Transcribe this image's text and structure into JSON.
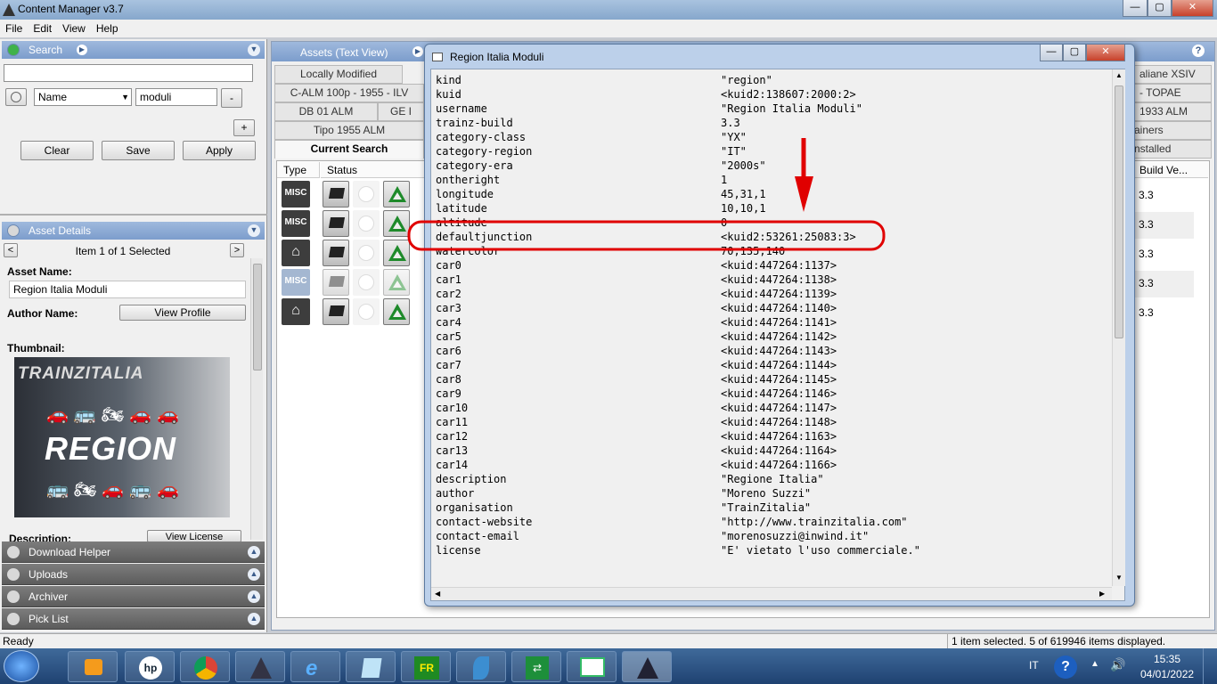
{
  "window": {
    "title": "Content Manager v3.7"
  },
  "menu": [
    "File",
    "Edit",
    "View",
    "Help"
  ],
  "search": {
    "header": "Search",
    "query_value": "",
    "field_select": "Name",
    "field_value": "moduli",
    "minus_label": "-",
    "plus_label": "+",
    "clear_label": "Clear",
    "save_label": "Save",
    "apply_label": "Apply"
  },
  "asset_details": {
    "header": "Asset Details",
    "nav_prev": "<",
    "nav_next": ">",
    "selection": "Item 1 of 1 Selected",
    "asset_name_label": "Asset Name:",
    "asset_name_value": "Region Italia Moduli",
    "author_label": "Author Name:",
    "view_profile_label": "View Profile",
    "thumbnail_label": "Thumbnail:",
    "thumb_brand": "TRAINZITALIA",
    "thumb_title": "REGION",
    "description_label": "Description:",
    "view_license_label": "View License"
  },
  "collapsed_panels": [
    "Download Helper",
    "Uploads",
    "Archiver",
    "Pick List"
  ],
  "assets_panel": {
    "header_tab": "Assets (Text View)",
    "help": "?",
    "tabs_row1": [
      "Locally Modified"
    ],
    "tabs_row2": [
      "C-ALM 100p - 1955 - ILV"
    ],
    "tabs_row3": [
      "DB 01 ALM",
      "GE I"
    ],
    "tabs_row4": [
      "Tipo 1955 ALM"
    ],
    "current_search": "Current Search",
    "right_tabs": [
      "aliane XSIV",
      "- TOPAE",
      "1933 ALM",
      "ainers",
      "nstalled"
    ],
    "columns": {
      "type": "Type",
      "status": "Status",
      "build": "Build Ve..."
    },
    "rows": [
      {
        "type": "MISC",
        "build": "3.3"
      },
      {
        "type": "MISC",
        "build": "3.3"
      },
      {
        "type": "HOME",
        "build": "3.3"
      },
      {
        "type": "MISC",
        "build": "3.3"
      },
      {
        "type": "HOME",
        "build": "3.3"
      }
    ]
  },
  "dialog": {
    "title": "Region Italia Moduli",
    "min": "—",
    "max": "▢",
    "close": "✕",
    "properties": [
      {
        "k": "kind",
        "v": "\"region\""
      },
      {
        "k": "kuid",
        "v": "<kuid2:138607:2000:2>"
      },
      {
        "k": "username",
        "v": "\"Region Italia Moduli\""
      },
      {
        "k": "trainz-build",
        "v": "3.3"
      },
      {
        "k": "category-class",
        "v": "\"YX\""
      },
      {
        "k": "category-region",
        "v": "\"IT\""
      },
      {
        "k": "category-era",
        "v": "\"2000s\""
      },
      {
        "k": "ontheright",
        "v": "1"
      },
      {
        "k": "longitude",
        "v": "45,31,1"
      },
      {
        "k": "latitude",
        "v": "10,10,1"
      },
      {
        "k": "altitude",
        "v": "0"
      },
      {
        "k": "defaultjunction",
        "v": "<kuid2:53261:25083:3>"
      },
      {
        "k": "watercolor",
        "v": "70,135,140"
      },
      {
        "k": "car0",
        "v": "<kuid:447264:1137>"
      },
      {
        "k": "car1",
        "v": "<kuid:447264:1138>"
      },
      {
        "k": "car2",
        "v": "<kuid:447264:1139>"
      },
      {
        "k": "car3",
        "v": "<kuid:447264:1140>"
      },
      {
        "k": "car4",
        "v": "<kuid:447264:1141>"
      },
      {
        "k": "car5",
        "v": "<kuid:447264:1142>"
      },
      {
        "k": "car6",
        "v": "<kuid:447264:1143>"
      },
      {
        "k": "car7",
        "v": "<kuid:447264:1144>"
      },
      {
        "k": "car8",
        "v": "<kuid:447264:1145>"
      },
      {
        "k": "car9",
        "v": "<kuid:447264:1146>"
      },
      {
        "k": "car10",
        "v": "<kuid:447264:1147>"
      },
      {
        "k": "car11",
        "v": "<kuid:447264:1148>"
      },
      {
        "k": "car12",
        "v": "<kuid:447264:1163>"
      },
      {
        "k": "car13",
        "v": "<kuid:447264:1164>"
      },
      {
        "k": "car14",
        "v": "<kuid:447264:1166>"
      },
      {
        "k": "description",
        "v": "\"Regione Italia\""
      },
      {
        "k": "author",
        "v": "\"Moreno Suzzi\""
      },
      {
        "k": "organisation",
        "v": "\"TrainZitalia\""
      },
      {
        "k": "contact-website",
        "v": "\"http://www.trainzitalia.com\""
      },
      {
        "k": "contact-email",
        "v": "\"morenosuzzi@inwind.it\""
      },
      {
        "k": "license",
        "v": "\"E' vietato l'uso commerciale.\""
      }
    ]
  },
  "annotation": {
    "color": "#e00000"
  },
  "statusbar": {
    "left": "Ready",
    "right": "1 item selected. 5 of 619946 items displayed."
  },
  "taskbar": {
    "lang": "IT",
    "time": "15:35",
    "date": "04/01/2022"
  },
  "colors": {
    "accent": "#7c9dcc",
    "dialog_frame": "#bcd0ea",
    "taskbar": "#1f4271"
  }
}
